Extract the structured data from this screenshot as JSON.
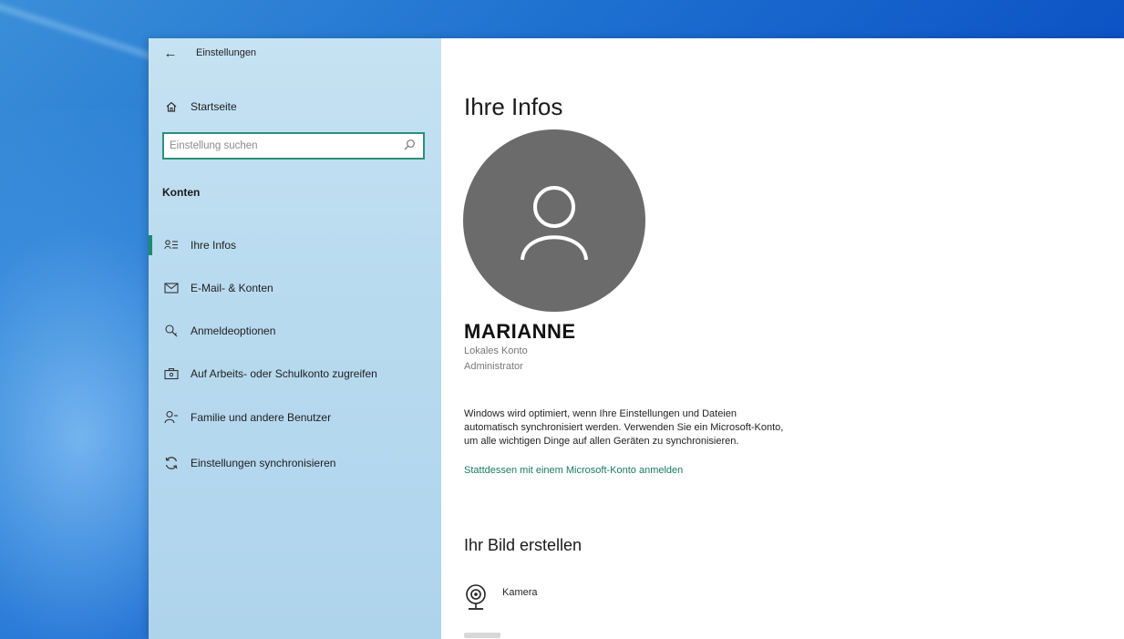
{
  "window": {
    "title": "Einstellungen"
  },
  "sidebar": {
    "home_label": "Startseite",
    "search": {
      "placeholder": "Einstellung suchen"
    },
    "section_header": "Konten",
    "items": [
      {
        "label": "Ihre Infos",
        "icon": "contact-card-icon",
        "active": true
      },
      {
        "label": "E-Mail- & Konten",
        "icon": "mail-icon",
        "active": false
      },
      {
        "label": "Anmeldeoptionen",
        "icon": "key-icon",
        "active": false
      },
      {
        "label": "Auf Arbeits- oder Schulkonto zugreifen",
        "icon": "briefcase-icon",
        "active": false
      },
      {
        "label": "Familie und andere Benutzer",
        "icon": "person-add-icon",
        "active": false
      },
      {
        "label": "Einstellungen synchronisieren",
        "icon": "sync-icon",
        "active": false
      }
    ]
  },
  "main": {
    "title": "Ihre Infos",
    "user": {
      "name": "MARIANNE",
      "account_type": "Lokales Konto",
      "role": "Administrator"
    },
    "description_lines": [
      "Windows wird optimiert, wenn Ihre Einstellungen und Dateien",
      "automatisch synchronisiert werden. Verwenden Sie ein Microsoft-Konto,",
      "um alle wichtigen Dinge auf allen Geräten zu synchronisieren."
    ],
    "ms_link": "Stattdessen mit einem Microsoft-Konto anmelden",
    "picture_heading": "Ihr Bild erstellen",
    "camera_label": "Kamera"
  },
  "colors": {
    "accent": "#1b7a62",
    "sidebar_bg": "#bcdcef",
    "avatar_bg": "#6b6b6b",
    "desktop_blue": "#0a4fc4"
  }
}
